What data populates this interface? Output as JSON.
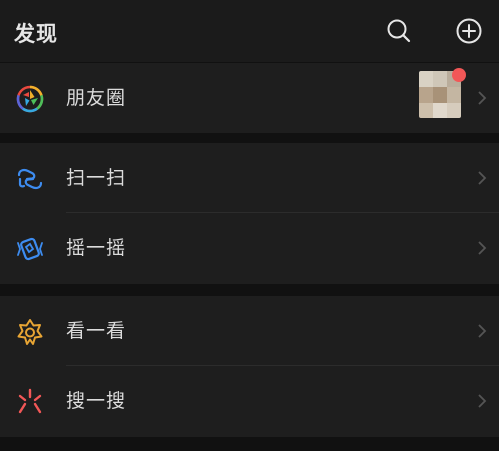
{
  "header": {
    "title": "发现",
    "search_icon": "search-icon",
    "add_icon": "plus-circle-icon"
  },
  "menu": {
    "moments": {
      "label": "朋友圈",
      "icon": "moments-aperture-icon",
      "has_notification_dot": true,
      "notification_color": "#f25757"
    },
    "scan": {
      "label": "扫一扫",
      "icon": "scan-icon",
      "color": "#3d8cf0"
    },
    "shake": {
      "label": "摇一摇",
      "icon": "shake-icon",
      "color": "#3d8cf0"
    },
    "top_stories": {
      "label": "看一看",
      "icon": "top-stories-icon",
      "color": "#e8a534"
    },
    "search": {
      "label": "搜一搜",
      "icon": "search-sparkle-icon",
      "color": "#f25757"
    }
  },
  "colors": {
    "background": "#111111",
    "row_background": "#1e1e1e",
    "text": "#dcdcdc",
    "chevron": "#555555"
  }
}
